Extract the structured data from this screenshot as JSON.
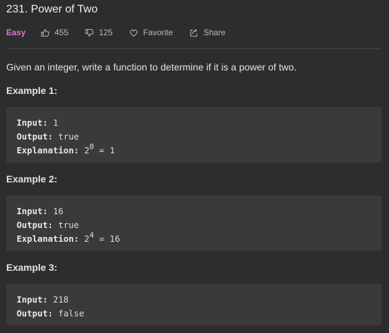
{
  "problem": {
    "title": "231. Power of Two",
    "difficulty": "Easy",
    "likes": "455",
    "dislikes": "125",
    "favorite_label": "Favorite",
    "share_label": "Share",
    "description": "Given an integer, write a function to determine if it is a power of two."
  },
  "labels": {
    "input": "Input:",
    "output": "Output:",
    "explanation": "Explanation:"
  },
  "examples": [
    {
      "title": "Example 1:",
      "input": "1",
      "output": "true",
      "explanation_base": "2",
      "explanation_exp": "0",
      "explanation_rest": " = 1"
    },
    {
      "title": "Example 2:",
      "input": "16",
      "output": "true",
      "explanation_base": "2",
      "explanation_exp": "4",
      "explanation_rest": " = 16"
    },
    {
      "title": "Example 3:",
      "input": "218",
      "output": "false"
    }
  ],
  "colors": {
    "background": "#2d2d2d",
    "code_block": "#3a3a3a",
    "easy": "#d878c8"
  },
  "icons": {
    "like": "thumbs-up-icon",
    "dislike": "thumbs-down-icon",
    "favorite": "heart-icon",
    "share": "share-icon"
  }
}
